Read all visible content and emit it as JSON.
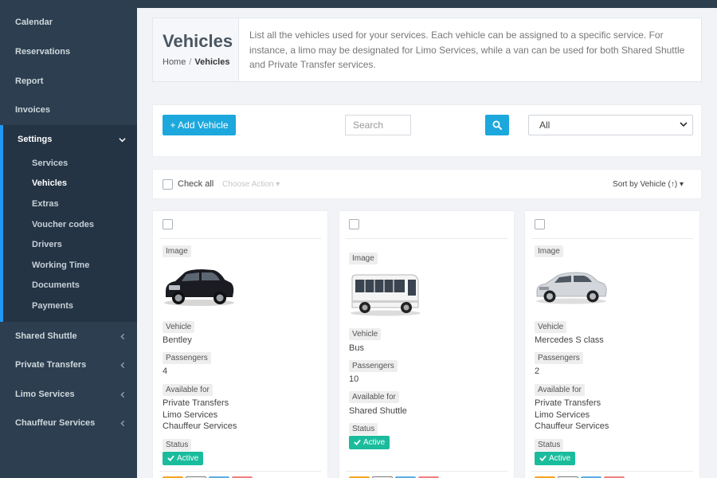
{
  "sidebar": {
    "items": [
      {
        "label": "Calendar"
      },
      {
        "label": "Reservations"
      },
      {
        "label": "Report"
      },
      {
        "label": "Invoices"
      },
      {
        "label": "Settings"
      }
    ],
    "settings_sub": [
      {
        "label": "Services"
      },
      {
        "label": "Vehicles"
      },
      {
        "label": "Extras"
      },
      {
        "label": "Voucher codes"
      },
      {
        "label": "Drivers"
      },
      {
        "label": "Working Time"
      },
      {
        "label": "Documents"
      },
      {
        "label": "Payments"
      }
    ],
    "groups": [
      {
        "label": "Shared Shuttle"
      },
      {
        "label": "Private Transfers"
      },
      {
        "label": "Limo Services"
      },
      {
        "label": "Chauffeur Services"
      }
    ]
  },
  "header": {
    "title": "Vehicles",
    "breadcrumb_home": "Home",
    "breadcrumb_sep": "/",
    "breadcrumb_current": "Vehicles",
    "description": "List all the vehicles used for your services. Each vehicle can be assigned to a specific service. For instance, a limo may be designated for Limo Services, while a van can be used for both Shared Shuttle and Private Transfer services."
  },
  "toolbar": {
    "add_label": "+ Add Vehicle",
    "search_placeholder": "Search",
    "filter_selected": "All"
  },
  "actionbar": {
    "check_all": "Check all",
    "choose_action": "Choose Action ▾",
    "sort_by": "Sort by Vehicle (↑) ▾"
  },
  "cards": [
    {
      "image_label": "Image",
      "vehicle_label": "Vehicle",
      "vehicle": "Bentley",
      "passengers_label": "Passengers",
      "passengers": "4",
      "available_label": "Available for",
      "available": [
        "Private Transfers",
        "Limo Services",
        "Chauffeur Services"
      ],
      "status_label": "Status",
      "status": "Active"
    },
    {
      "image_label": "Image",
      "vehicle_label": "Vehicle",
      "vehicle": "Bus",
      "passengers_label": "Passengers",
      "passengers": "10",
      "available_label": "Available for",
      "available": [
        "Shared Shuttle"
      ],
      "status_label": "Status",
      "status": "Active"
    },
    {
      "image_label": "Image",
      "vehicle_label": "Vehicle",
      "vehicle": "Mercedes S class",
      "passengers_label": "Passengers",
      "passengers": "2",
      "available_label": "Available for",
      "available": [
        "Private Transfers",
        "Limo Services",
        "Chauffeur Services"
      ],
      "status_label": "Status",
      "status": "Active"
    }
  ],
  "colors": {
    "sidebar_bg": "#2c3e50",
    "accent": "#1ca8dd",
    "active_badge": "#1abc9c",
    "active_border": "#2196f3"
  }
}
